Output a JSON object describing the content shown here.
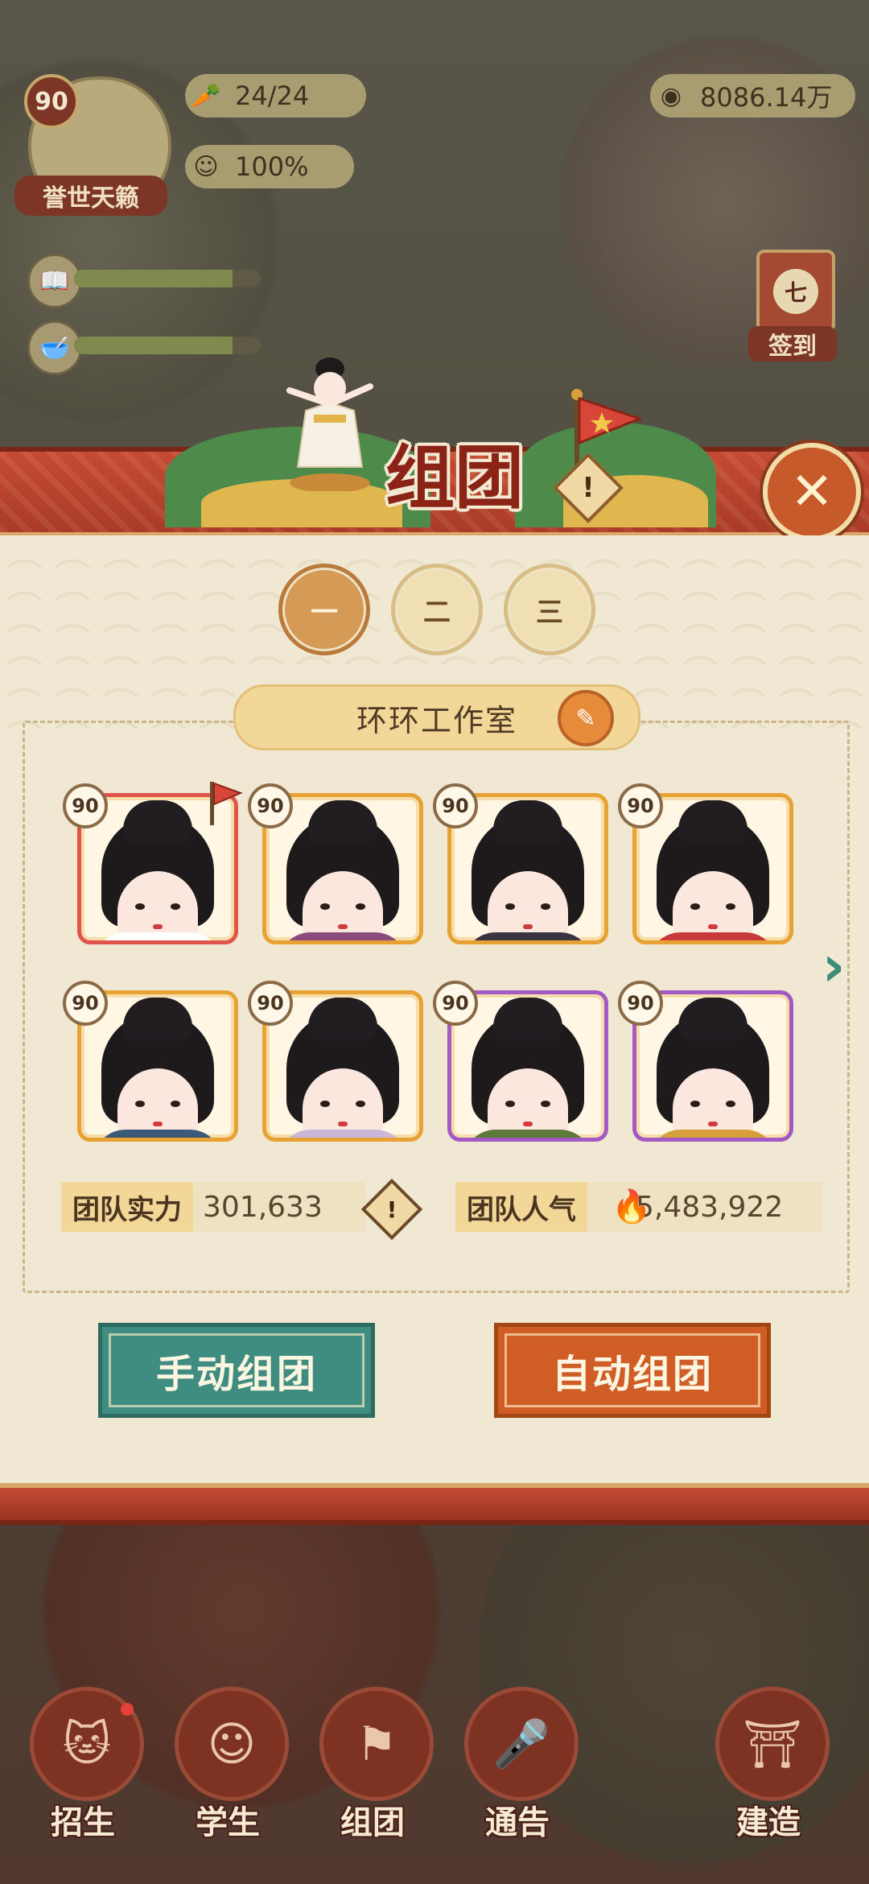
{
  "hud": {
    "level": "90",
    "title": "誉世天籁",
    "stamina": "24/24",
    "mood": "100%",
    "coins": "8086.14万",
    "study_progress": 0.85,
    "food_progress": 0.85
  },
  "checkin": {
    "badge": "七",
    "label": "签到"
  },
  "panel": {
    "title": "组团",
    "help_icon": "exclamation-icon",
    "close_icon": "close-icon",
    "tabs": [
      "一",
      "二",
      "三"
    ],
    "active_tab": 0,
    "team_name": "环环工作室",
    "members": [
      {
        "level": "90",
        "frame": "red",
        "robe": "#ffffff",
        "leader": true
      },
      {
        "level": "90",
        "frame": "gold",
        "robe": "#8a4a7c"
      },
      {
        "level": "90",
        "frame": "gold",
        "robe": "#3a3440"
      },
      {
        "level": "90",
        "frame": "gold",
        "robe": "#c83a3a"
      },
      {
        "level": "90",
        "frame": "gold",
        "robe": "#3b5a7a"
      },
      {
        "level": "90",
        "frame": "gold",
        "robe": "#c9b6d8"
      },
      {
        "level": "90",
        "frame": "purple",
        "robe": "#5e7a3a"
      },
      {
        "level": "90",
        "frame": "purple",
        "robe": "#d8a03a"
      }
    ],
    "power_label": "团队实力",
    "power_value": "301,633",
    "popularity_label": "团队人气",
    "popularity_value": "5,483,922",
    "manual_button": "手动组团",
    "auto_button": "自动组团"
  },
  "bottom_nav": [
    {
      "label": "招生",
      "icon": "cat-mask-icon"
    },
    {
      "label": "学生",
      "icon": "student-face-icon"
    },
    {
      "label": "组团",
      "icon": "flag-icon"
    },
    {
      "label": "通告",
      "icon": "microphone-icon"
    },
    {
      "label": "建造",
      "icon": "building-icon"
    }
  ],
  "colors": {
    "accent_red": "#c54b33",
    "teal": "#3f8d80",
    "orange": "#cf5d25",
    "gold_frame": "#e7a233",
    "purple_frame": "#a35ac4"
  }
}
